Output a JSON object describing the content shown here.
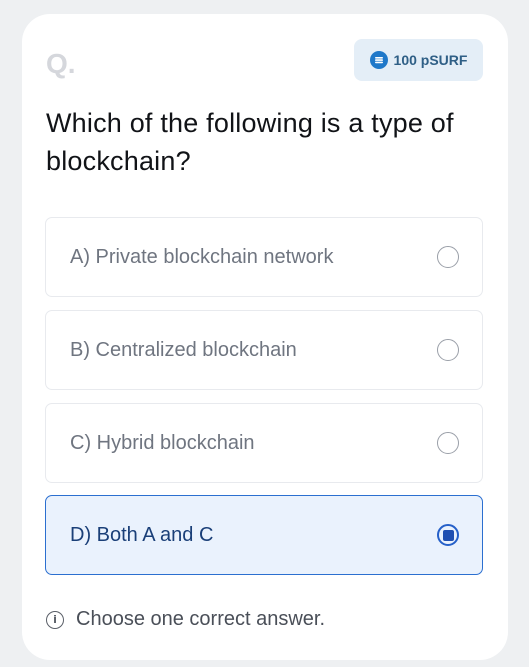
{
  "question_marker": "Q.",
  "reward": {
    "amount_label": "100 pSURF",
    "icon": "coin-icon",
    "color": "#1f78c9"
  },
  "question": {
    "text": "Which of the following is a type of blockchain?"
  },
  "options": [
    {
      "label": "A) Private blockchain network",
      "selected": false
    },
    {
      "label": "B) Centralized blockchain",
      "selected": false
    },
    {
      "label": "C) Hybrid blockchain",
      "selected": false
    },
    {
      "label": "D) Both A and C",
      "selected": true
    }
  ],
  "hint": {
    "icon": "info-icon",
    "text": "Choose one correct answer."
  },
  "colors": {
    "accent": "#2b6fd0",
    "selected_bg": "#eaf2fd"
  }
}
